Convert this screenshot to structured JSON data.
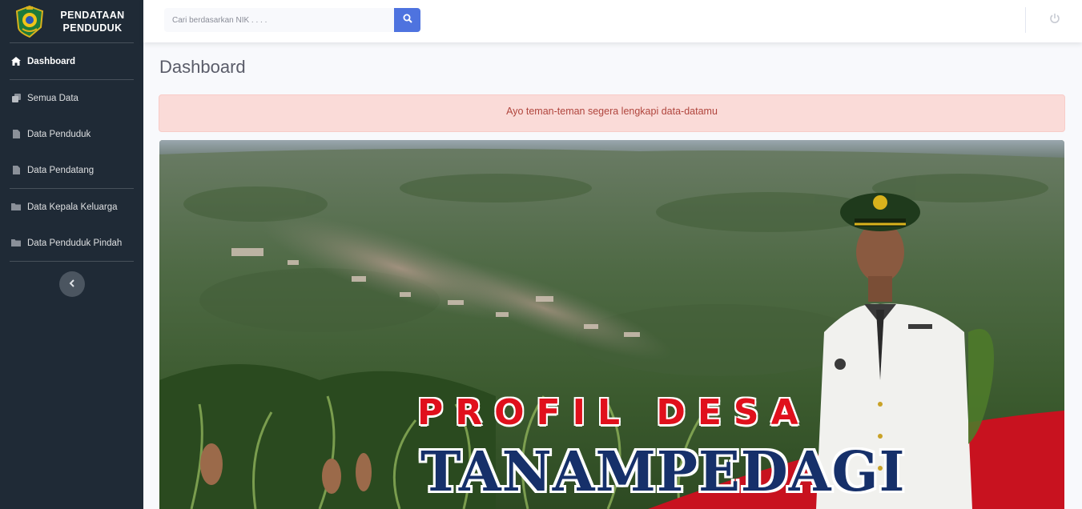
{
  "app": {
    "brand_line1": "PENDATAAN",
    "brand_line2": "PENDUDUK",
    "logo_icon": "regency-emblem-icon"
  },
  "sidebar": {
    "items": [
      {
        "label": "Dashboard",
        "icon": "home-icon",
        "active": true
      },
      {
        "label": "Semua Data",
        "icon": "copy-icon",
        "active": false
      },
      {
        "label": "Data Penduduk",
        "icon": "file-icon",
        "active": false
      },
      {
        "label": "Data Pendatang",
        "icon": "file-icon",
        "active": false
      },
      {
        "label": "Data Kepala Keluarga",
        "icon": "folder-icon",
        "active": false
      },
      {
        "label": "Data Penduduk Pindah",
        "icon": "folder-icon",
        "active": false
      }
    ],
    "toggle_icon": "chevron-left-icon"
  },
  "topbar": {
    "search_placeholder": "Cari berdasarkan NIK . . . .",
    "search_icon": "search-icon",
    "power_icon": "power-icon"
  },
  "main": {
    "page_title": "Dashboard",
    "alert_text": "Ayo teman-teman segera lengkapi data-datamu",
    "banner": {
      "title_line1": "PROFIL DESA",
      "title_line2": "TANAMPEDAGI"
    }
  },
  "colors": {
    "sidebar_bg": "#1f2a36",
    "accent": "#4e73df",
    "alert_bg": "#fadbd8",
    "alert_text": "#b0453d",
    "banner_red": "#e0101c",
    "banner_navy": "#16306a"
  }
}
